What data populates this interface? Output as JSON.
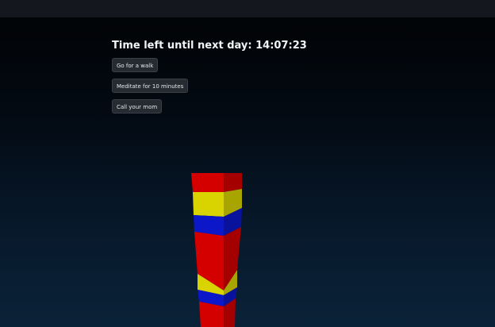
{
  "timer": {
    "label": "Time left until next day:",
    "value": "14:07:23"
  },
  "tasks": [
    {
      "label": "Go for a walk"
    },
    {
      "label": "Meditate for 10 minutes"
    },
    {
      "label": "Call your mom"
    }
  ],
  "tower": {
    "stack_bottom_to_top": [
      "red",
      "blue",
      "yellow",
      "red",
      "blue",
      "yellow",
      "red"
    ],
    "colors": {
      "red": "#d40000",
      "yellow": "#d9d400",
      "blue": "#0b17c8",
      "background_top": "#010203",
      "background_bottom": "#0a2238"
    }
  }
}
